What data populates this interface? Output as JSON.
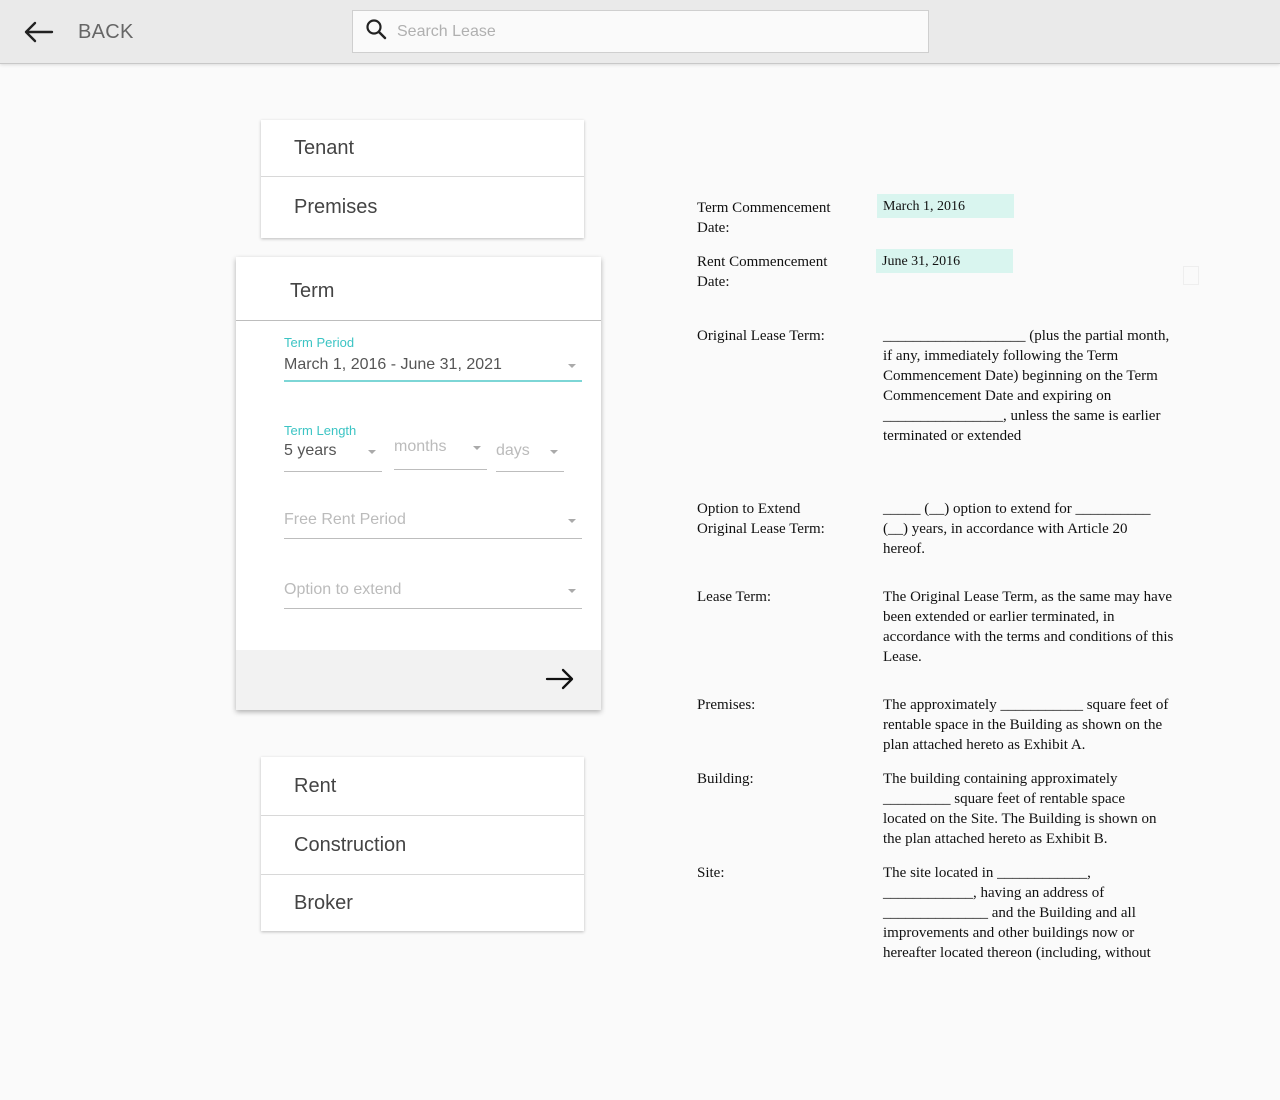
{
  "topbar": {
    "back_label": "BACK",
    "search_placeholder": "Search Lease"
  },
  "nav": {
    "top_items": [
      "Tenant",
      "Premises"
    ],
    "bottom_items": [
      "Rent",
      "Construction",
      "Broker"
    ]
  },
  "term_panel": {
    "title": "Term",
    "term_period": {
      "label": "Term Period",
      "value": "March 1, 2016 - June 31, 2021"
    },
    "term_length": {
      "label": "Term Length",
      "years": "5 years",
      "months": "months",
      "days": "days"
    },
    "free_rent_period": {
      "placeholder": "Free Rent Period"
    },
    "option_to_extend": {
      "placeholder": "Option to extend"
    }
  },
  "document": {
    "term_commencement": {
      "label": "Term Commencement Date:",
      "value": "March 1, 2016"
    },
    "rent_commencement": {
      "label": "Rent Commencement Date:",
      "value": "June 31, 2016"
    },
    "original_lease_term": {
      "label": "Original Lease Term:",
      "text": "___________________ (plus the partial month, if any, immediately following the Term Commencement Date) beginning on the Term Commencement Date and expiring on ________________, unless the same is earlier terminated or extended"
    },
    "option_to_extend": {
      "label": "Option to Extend Original Lease Term:",
      "text": "_____ (__) option to extend for __________ (__) years, in accordance with Article 20 hereof."
    },
    "lease_term": {
      "label": "Lease Term:",
      "text": "The Original Lease Term, as the same may have been extended or earlier terminated, in accordance with the terms and conditions of this Lease."
    },
    "premises": {
      "label": "Premises:",
      "text": "The approximately ___________ square feet of rentable space in the Building as shown on the plan attached hereto as Exhibit A."
    },
    "building": {
      "label": "Building:",
      "text": "The building containing approximately _________ square feet of rentable space located on the Site.  The Building is shown on the plan attached hereto as Exhibit B."
    },
    "site": {
      "label": "Site:",
      "text": "The site located in ____________, ____________, having an address of ______________ and the Building and all improvements and other buildings now or hereafter located thereon (including, without"
    }
  },
  "icons": [
    "back-arrow-icon",
    "search-icon",
    "next-arrow-icon",
    "dropdown-caret-icon"
  ],
  "colors": {
    "accent": "#3cc4c4",
    "highlight": "#d9f5ef",
    "topbar": "#eaeaea"
  }
}
